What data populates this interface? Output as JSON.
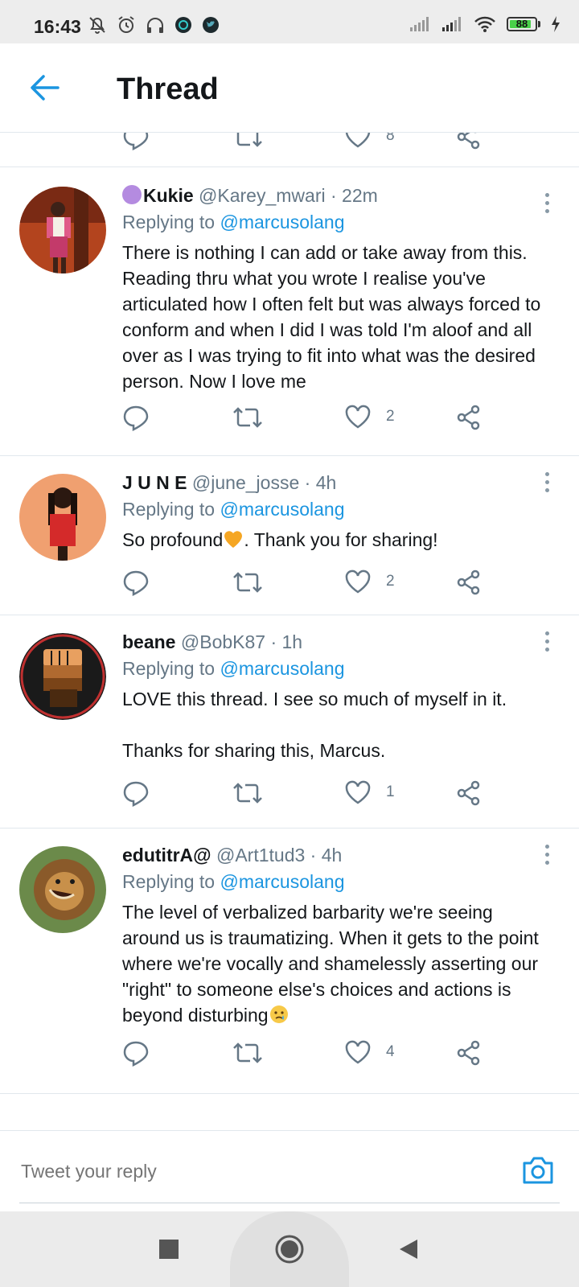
{
  "status_bar": {
    "time": "16:43",
    "battery": "88",
    "battery_level": 0.88,
    "left_icons": [
      "notifications-off-icon",
      "alarm-icon",
      "headset-icon",
      "app-notification-icon",
      "twitter-notification-icon"
    ],
    "right_icons": [
      "signal-icon",
      "signal-icon",
      "wifi-icon",
      "battery-icon",
      "charging-icon"
    ]
  },
  "header": {
    "title": "Thread",
    "back_icon": "back-arrow-icon"
  },
  "colors": {
    "accent": "#1b95e0",
    "muted": "#657786",
    "divider": "#e1e8ed"
  },
  "top_actions": {
    "like_count": "8"
  },
  "tweets": [
    {
      "display_name": "Kukie",
      "name_prefix_icon": "purple-circle-emoji",
      "handle": "@Karey_mwari",
      "time": "· 22m",
      "replying_label": "Replying to",
      "replying_to": "@marcusolang",
      "text": "There is nothing I can add or take away from this. Reading thru what you wrote I realise you've articulated how I often felt but was always forced to conform and when I did I was told I'm aloof and all over as I was trying to fit into what was the desired person. Now I love me",
      "like_count": "2"
    },
    {
      "display_name": "J U N E",
      "handle": "@june_josse",
      "time": "· 4h",
      "replying_label": "Replying to",
      "replying_to": "@marcusolang",
      "text": "So profound",
      "text_emoji": "orange-heart-emoji",
      "text_after": ". Thank you for sharing!",
      "like_count": "2"
    },
    {
      "display_name": "beane",
      "handle": "@BobK87",
      "time": "· 1h",
      "replying_label": "Replying to",
      "replying_to": "@marcusolang",
      "text": "LOVE this thread. I see so much of myself in it.\n\nThanks for sharing this, Marcus.",
      "like_count": "1"
    },
    {
      "display_name": "edutitrA@",
      "handle": "@Art1tud3",
      "time": "· 4h",
      "replying_label": "Replying to",
      "replying_to": "@marcusolang",
      "text": "The level of verbalized barbarity we're seeing around us is traumatizing. When it gets to the point where we're vocally and shamelessly asserting our \"right\" to someone else's choices and actions is beyond disturbing",
      "text_emoji": "crying-face-emoji",
      "like_count": "4"
    }
  ],
  "composer": {
    "placeholder": "Tweet your reply",
    "camera_icon": "camera-icon"
  },
  "nav_bar": {
    "buttons": [
      "recents-square-icon",
      "home-circle-icon",
      "back-triangle-icon"
    ]
  }
}
